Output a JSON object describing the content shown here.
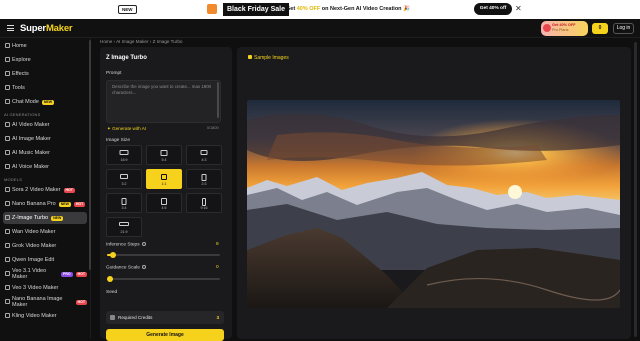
{
  "promo": {
    "new_badge": "NEW",
    "sale_title": "Black Friday Sale",
    "offer_prefix": "Get ",
    "offer_highlight": "40% OFF",
    "offer_suffix": " on Next-Gen AI Video Creation 🎉",
    "cta": "Get 40% off",
    "close": "✕"
  },
  "header": {
    "logo_main": "Super",
    "logo_accent": "Maker",
    "promo_line1": "Get 40% OFF",
    "promo_line2": "Pro Plans",
    "coin_count": "0",
    "login": "Log in"
  },
  "sidebar": {
    "main": [
      {
        "label": "Home",
        "icon": "home-icon"
      },
      {
        "label": "Explore",
        "icon": "compass-icon"
      },
      {
        "label": "Effects",
        "icon": "sparkle-icon"
      },
      {
        "label": "Tools",
        "icon": "wrench-icon"
      },
      {
        "label": "Chat Mode",
        "icon": "chat-icon",
        "badge": "NEW"
      }
    ],
    "section_generations": "AI GENERATIONS",
    "generations": [
      {
        "label": "AI Video Maker",
        "icon": "video-icon"
      },
      {
        "label": "AI Image Maker",
        "icon": "image-icon"
      },
      {
        "label": "AI Music Maker",
        "icon": "music-icon"
      },
      {
        "label": "AI Voice Maker",
        "icon": "voice-icon"
      }
    ],
    "section_models": "MODELS",
    "models": [
      {
        "label": "Sora 2 Video Maker",
        "badges": [
          "HOT"
        ]
      },
      {
        "label": "Nano Banana Pro",
        "badges": [
          "NEW",
          "HOT"
        ]
      },
      {
        "label": "Z-Image Turbo",
        "badges": [
          "NEW"
        ],
        "active": true
      },
      {
        "label": "Wan Video Maker",
        "badges": []
      },
      {
        "label": "Grok Video Maker",
        "badges": []
      },
      {
        "label": "Qwen Image Edit",
        "badges": []
      },
      {
        "label": "Veo 3.1 Video Maker",
        "badges": [
          "PRO",
          "HOT"
        ]
      },
      {
        "label": "Veo 3 Video Maker",
        "badges": []
      },
      {
        "label": "Nano Banana Image Maker",
        "badges": [
          "HOT"
        ]
      },
      {
        "label": "Kling Video Maker",
        "badges": []
      }
    ]
  },
  "breadcrumb": "Home  ›  AI Image Maker  ›  Z Image Turbo",
  "panel": {
    "title": "Z Image Turbo",
    "prompt_label": "Prompt",
    "prompt_placeholder": "Describe the image you want to create... max 1800 characters...",
    "generate_ai": "✦ Generate with AI",
    "char_count": "0/1800",
    "image_size_label": "Image Size",
    "sizes": [
      {
        "label": "16:9",
        "w": 9,
        "h": 5
      },
      {
        "label": "5:4",
        "w": 7,
        "h": 6
      },
      {
        "label": "4:3",
        "w": 7,
        "h": 5
      },
      {
        "label": "3:2",
        "w": 8,
        "h": 5
      },
      {
        "label": "1:1",
        "w": 6,
        "h": 6,
        "selected": true
      },
      {
        "label": "2:3",
        "w": 5,
        "h": 7
      },
      {
        "label": "3:4",
        "w": 5,
        "h": 7
      },
      {
        "label": "4:5",
        "w": 6,
        "h": 7
      },
      {
        "label": "9:16",
        "w": 4,
        "h": 8
      },
      {
        "label": "21:9",
        "w": 10,
        "h": 4
      }
    ],
    "inference_label": "Inference Steps",
    "inference_value": "8",
    "inference_fraction": 0.05,
    "guidance_label": "Guidance Scale",
    "guidance_value": "0",
    "guidance_fraction": 0.0,
    "seed_label": "Seed",
    "credits_label": "Required Credits",
    "credits_value": "3",
    "generate_button": "Generate Image"
  },
  "right": {
    "sample_label": "Sample Images"
  },
  "colors": {
    "accent": "#f6d21d",
    "background": "#0f0f10",
    "panel": "#1a1a1c"
  }
}
